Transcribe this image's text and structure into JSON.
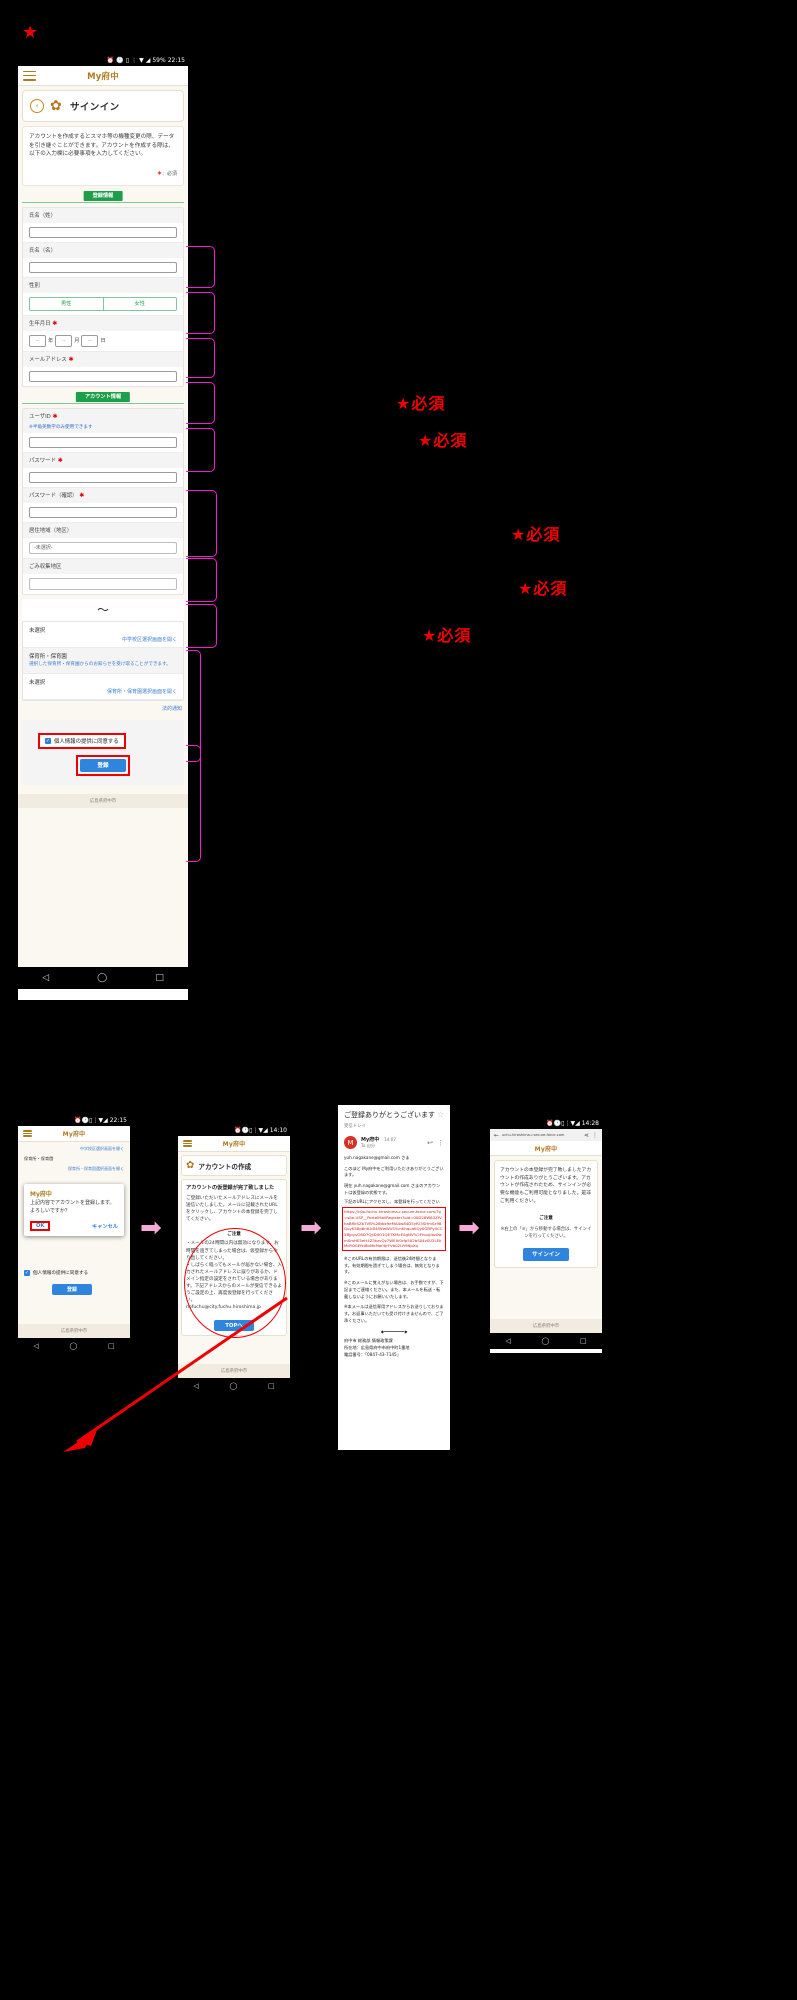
{
  "main_phone": {
    "status_time": "22:15",
    "status_battery": "59%",
    "app_title": "My府中",
    "page_title": "サインイン",
    "intro": "アカウントを作成するとスマホ等の機種変更の際、データを引き継ぐことができます。アカウントを作成する際は、以下の入力欄に必要事項を入力してください。",
    "required_note_star": "＊",
    "required_note_text": "：必須",
    "section_register": "登録情報",
    "section_account": "アカウント情報",
    "fields": {
      "lastname_label": "氏名（姓）",
      "firstname_label": "氏名（名）",
      "gender_label": "性別",
      "gender_male": "男性",
      "gender_female": "女性",
      "dob_label": "生年月日",
      "dob_year_ph": "--",
      "dob_year_unit": "年",
      "dob_month_ph": "--",
      "dob_month_unit": "月",
      "dob_day_ph": "--",
      "dob_day_unit": "日",
      "email_label": "メールアドレス",
      "userid_label": "ユーザID",
      "userid_hint": "※半角英数字のみ使用できます",
      "password_label": "パスワード",
      "password_confirm_label": "パスワード（確認）",
      "area_label": "居住地域（地区）",
      "area_value": "-未選択-",
      "garbage_label": "ごみ収集地区"
    },
    "school": {
      "value": "未選択",
      "link": "中学校区選択画面を開く"
    },
    "nursery": {
      "label": "保育所・保育園",
      "desc": "選択した保育所・保育園からのお知らせを受け取ることができます。",
      "value": "未選択",
      "link": "保育所・保育園選択画面を開く"
    },
    "law_link": "法的通知",
    "agree_label": "個人情報の提供に同意する",
    "register_button": "登録",
    "footer": "広島県府中市",
    "squiggle": "〜"
  },
  "annotations": {
    "required_marks": [
      "★必須",
      "★必須",
      "★必須",
      "★必須",
      "★必須"
    ],
    "top_star": "★"
  },
  "step1": {
    "status_time": "22:15",
    "app_title": "My府中",
    "bg_line1": "中学校区選択画面を開く",
    "bg_line2": "保育所・保育園",
    "bg_line3": "保育所・保育園選択画面を開く",
    "dialog_title": "My府中",
    "dialog_message": "上記内容でアカウントを登録します。よろしいですか？",
    "ok": "OK",
    "cancel": "キャンセル",
    "agree_label": "個人情報の提供に同意する",
    "register_button": "登録",
    "footer": "広島県府中市"
  },
  "step2": {
    "status_time": "14:10",
    "app_title": "My府中",
    "heading": "アカウントの作成",
    "subheading": "アカウントの仮登録が完了致しました",
    "body": "ご登録いただいたメールアドレスにメールを送信いたしました。メールに記載されたURLをクリックし、アカウントの本登録を完了してください。",
    "notice_title": "ご注意",
    "notice_body": "・メールの24時間以内は無効になります。お時間を過ぎてしまった場合は、仮登録からやり直してください。\n・しばらく経ってもメールが届かない場合、入力されたメールアドレスに誤りがあるか、ドメイン指定の設定をされている場合があります。下記アドレスからのメールが受信できるようご設定の上、再度仮登録を行ってください。\nnofuchu@city.fuchu.hiroshima.jp",
    "top_button": "TOPへ",
    "footer": "広島県府中市"
  },
  "step3": {
    "status_time": "",
    "subject": "ご登録ありがとうございます",
    "label": "受信トレイ",
    "avatar_letter": "M",
    "from": "My府中",
    "from_time": "14:07",
    "to": "To 自分",
    "sender_email": "yuh.nagakane@gmail.com",
    "sender_suffix": "さま",
    "body1": "このほど My府中をご利用いただきありがとうございます。",
    "body2": "現在 yuh.nagakane@gmail.com さまのアカウントは仮登録の状態です。",
    "body3": "下記のURLにアクセスし、本登録を行ってください",
    "url": "https://c0p-fuchu.hiroshima-r.secure.force.com/?p=site.USP__PortalMailRegister?oid=00D28W63ZfVhaBRkSZb7VB%28tbk9eMA4w84D5yfU3SHmSz98QuyK58p6nfLk84fWwWVSYcnKhqLbKQy0GRPyllCC5BJpyvO8D7QjlDXO1QE7KMcESgNV%2Fhoujlbz0wmSmHE5eH4Z3kzvQv7WEIV0rfp502bS04zSU2LEkMdY0GEfkI8bMkMaf4JrFVb02LR9NpXq",
    "note1": "※このURLの有効期限は、送信後24時間となります。有効期間を過ぎてしまう場合は、無効となります。",
    "note2": "※このメールに覚えがない場合は、お手数ですが、下記までご連絡ください。また、本メールを転送・転載しないようにお願いいたします。",
    "note3": "※本メールは送信専用アドレスからお送りしております。お返事いただいても受け付けきませんので、ご了承ください。",
    "sign1": "府中市 総務部 情報政策課",
    "sign2": "所在地：広島県府中市府中町1番地",
    "sign3": "電話番号：「0847-43-7145」"
  },
  "step4": {
    "status_time": "14:28",
    "url": "uchu-hiroshima-r.secure.force.com",
    "app_title": "My府中",
    "body": "アカウントの本登録が完了致しましたアカウントの作成ありがとうございます。アカウントが作成されたため、サインインが必要な機能もご利用可能となりました。是非ご利用ください。",
    "notice_title": "ご注意",
    "notice_body": "※右上の「≡」から移動する場合は、サインインを行ってください。",
    "signin_button": "サインイン",
    "footer": "広島県府中市"
  }
}
